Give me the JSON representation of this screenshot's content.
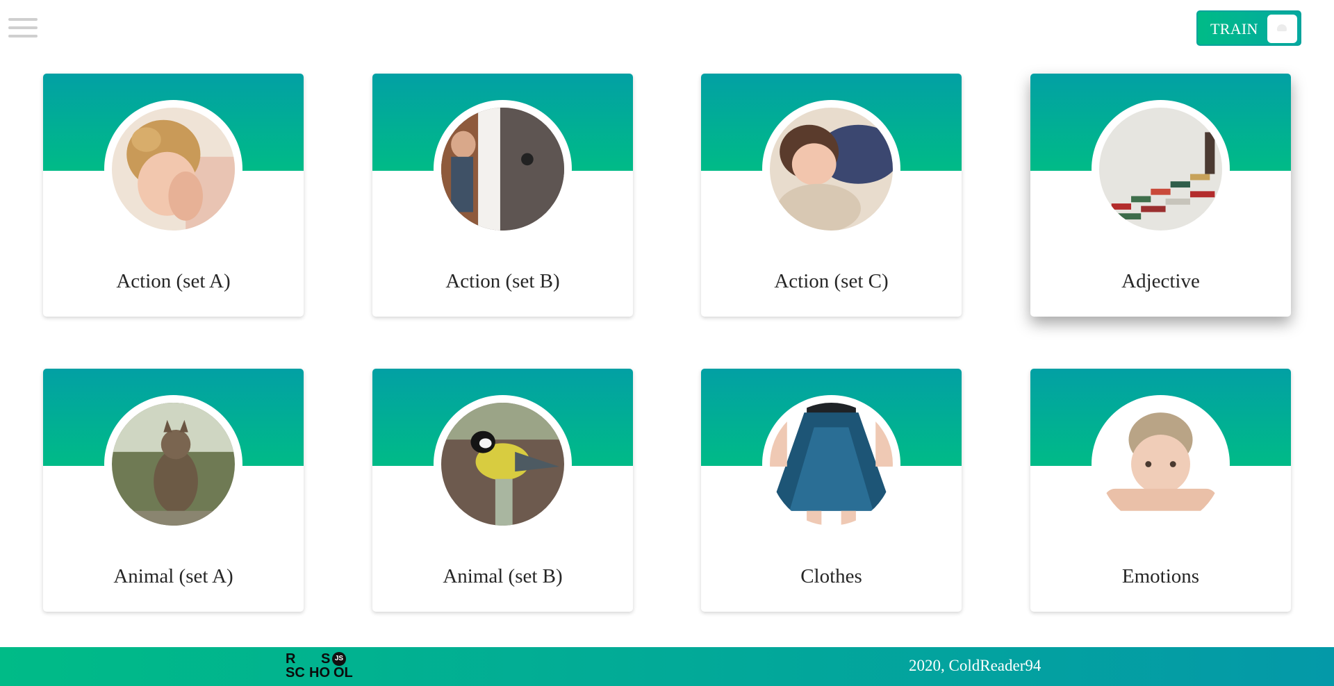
{
  "header": {
    "menu_icon": "hamburger-menu-icon",
    "mode_switch": {
      "label": "TRAIN"
    }
  },
  "categories": [
    {
      "title": "Action (set A)",
      "image": "child-covering-eyes"
    },
    {
      "title": "Action (set B)",
      "image": "child-opening-door"
    },
    {
      "title": "Action (set C)",
      "image": "child-sleeping"
    },
    {
      "title": "Adjective",
      "image": "stacked-books"
    },
    {
      "title": "Animal (set A)",
      "image": "sitting-cat"
    },
    {
      "title": "Animal (set B)",
      "image": "tit-bird-on-branch"
    },
    {
      "title": "Clothes",
      "image": "blue-skirt"
    },
    {
      "title": "Emotions",
      "image": "sad-boy"
    }
  ],
  "footer": {
    "logo": {
      "letters": [
        "R",
        "S",
        "SC",
        "HO",
        "OL"
      ],
      "badge": "JS"
    },
    "copyright": "2020, ColdReader94"
  },
  "colors": {
    "accent_start": "#00bb87",
    "accent_end": "#02a0a4"
  }
}
